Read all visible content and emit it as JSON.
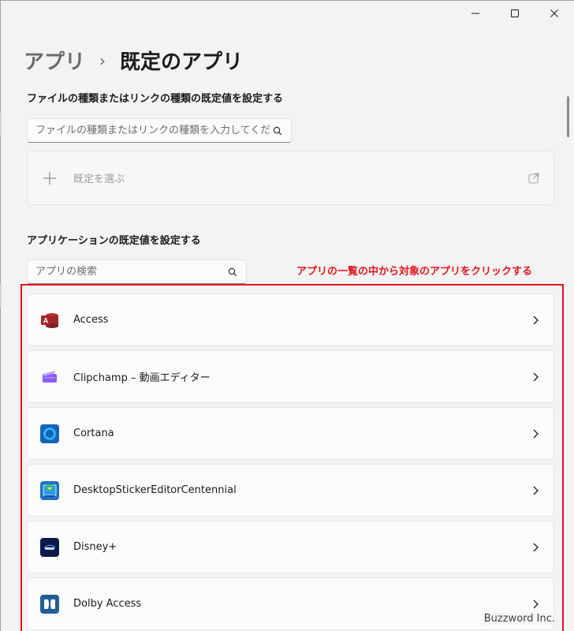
{
  "window": {
    "controls": {
      "minimize": "minimize-icon",
      "maximize": "maximize-icon",
      "close": "close-icon"
    }
  },
  "breadcrumb": {
    "parent": "アプリ",
    "separator": "›",
    "current": "既定のアプリ"
  },
  "file_type_section": {
    "title": "ファイルの種類またはリンクの種類の既定値を設定する",
    "search_placeholder": "ファイルの種類またはリンクの種類を入力してください",
    "choose_default_label": "既定を選ぶ"
  },
  "app_section": {
    "title": "アプリケーションの既定値を設定する",
    "search_placeholder": "アプリの検索",
    "annotation": "アプリの一覧の中から対象のアプリをクリックする",
    "annotation_color": "#e8121c",
    "apps": [
      {
        "name": "Access",
        "icon": "access-icon"
      },
      {
        "name": "Clipchamp – 動画エディター",
        "icon": "clipchamp-icon"
      },
      {
        "name": "Cortana",
        "icon": "cortana-icon"
      },
      {
        "name": "DesktopStickerEditorCentennial",
        "icon": "sticker-editor-icon"
      },
      {
        "name": "Disney+",
        "icon": "disney-plus-icon"
      },
      {
        "name": "Dolby Access",
        "icon": "dolby-access-icon"
      }
    ]
  },
  "watermark": "Buzzword Inc."
}
